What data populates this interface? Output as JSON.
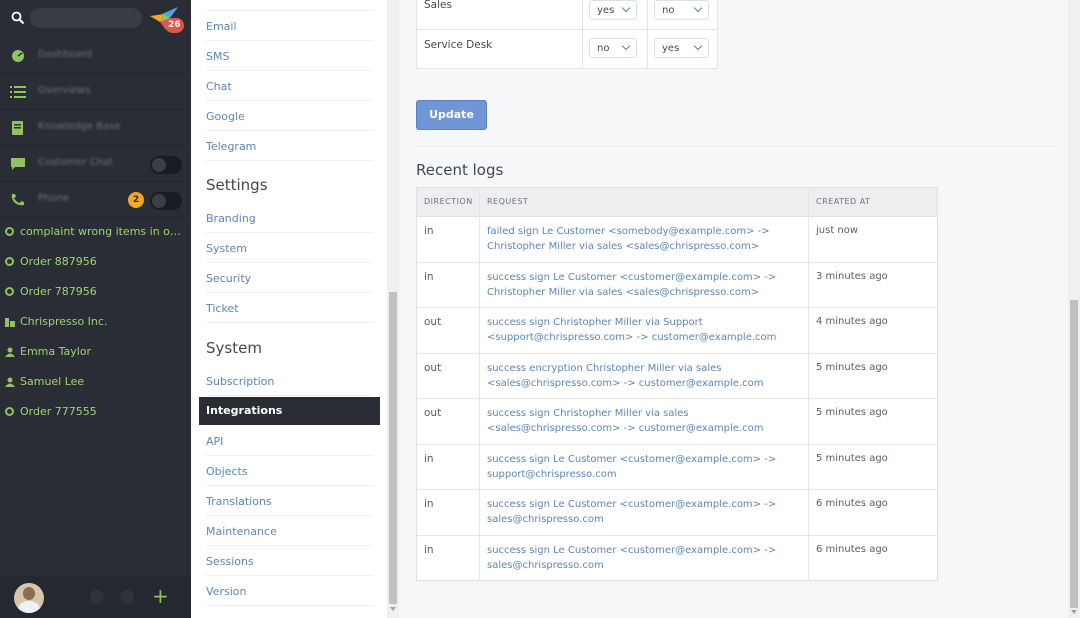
{
  "nav": {
    "logo_badge": "26",
    "main_items": [
      {
        "label": "Dashboard",
        "icon": "dashboard-icon"
      },
      {
        "label": "Overviews",
        "icon": "list-icon"
      },
      {
        "label": "Knowledge Base",
        "icon": "book-icon"
      },
      {
        "label": "Customer Chat",
        "icon": "chat-icon",
        "toggle": true
      },
      {
        "label": "Phone",
        "icon": "phone-icon",
        "toggle": true,
        "badge": "2"
      }
    ],
    "list_items": [
      {
        "label": "complaint wrong items in order ...",
        "icon": "ticket-icon"
      },
      {
        "label": "Order 887956",
        "icon": "ticket-icon"
      },
      {
        "label": "Order 787956",
        "icon": "ticket-icon"
      },
      {
        "label": "Chrispresso Inc.",
        "icon": "organization-icon"
      },
      {
        "label": "Emma Taylor",
        "icon": "user-icon"
      },
      {
        "label": "Samuel Lee",
        "icon": "user-icon"
      },
      {
        "label": "Order 777555",
        "icon": "ticket-icon"
      }
    ],
    "add_label": "+"
  },
  "menu": {
    "channels": [
      "Email",
      "SMS",
      "Chat",
      "Google",
      "Telegram"
    ],
    "settings_heading": "Settings",
    "settings": [
      "Branding",
      "System",
      "Security",
      "Ticket"
    ],
    "system_heading": "System",
    "system": [
      "Subscription",
      "Integrations",
      "API",
      "Objects",
      "Translations",
      "Maintenance",
      "Sessions",
      "Version"
    ],
    "active": "Integrations"
  },
  "visibility": [
    {
      "name": "Sales",
      "a": "yes",
      "b": "no"
    },
    {
      "name": "Service Desk",
      "a": "no",
      "b": "yes"
    }
  ],
  "update_label": "Update",
  "logs": {
    "title": "Recent logs",
    "headers": [
      "DIRECTION",
      "REQUEST",
      "CREATED AT"
    ],
    "rows": [
      {
        "direction": "in",
        "request": "failed sign Le Customer <somebody@example.com> -> Christopher Miller via sales <sales@chrispresso.com>",
        "created": "just now"
      },
      {
        "direction": "in",
        "request": "success sign Le Customer <customer@example.com> -> Christopher Miller via sales <sales@chrispresso.com>",
        "created": "3 minutes ago"
      },
      {
        "direction": "out",
        "request": "success sign Christopher Miller via Support <support@chrispresso.com> -> customer@example.com",
        "created": "4 minutes ago"
      },
      {
        "direction": "out",
        "request": "success encryption Christopher Miller via sales <sales@chrispresso.com> -> customer@example.com",
        "created": "5 minutes ago"
      },
      {
        "direction": "out",
        "request": "success sign Christopher Miller via sales <sales@chrispresso.com> -> customer@example.com",
        "created": "5 minutes ago"
      },
      {
        "direction": "in",
        "request": "success sign Le Customer <customer@example.com> -> support@chrispresso.com",
        "created": "5 minutes ago"
      },
      {
        "direction": "in",
        "request": "success sign Le Customer <customer@example.com> -> sales@chrispresso.com",
        "created": "6 minutes ago"
      },
      {
        "direction": "in",
        "request": "success sign Le Customer <customer@example.com> -> sales@chrispresso.com",
        "created": "6 minutes ago"
      }
    ]
  },
  "colors": {
    "accent": "#5d86b6",
    "nav_bg": "#2a2d35",
    "nav_link": "#9fd371",
    "button": "#6f97d6"
  }
}
